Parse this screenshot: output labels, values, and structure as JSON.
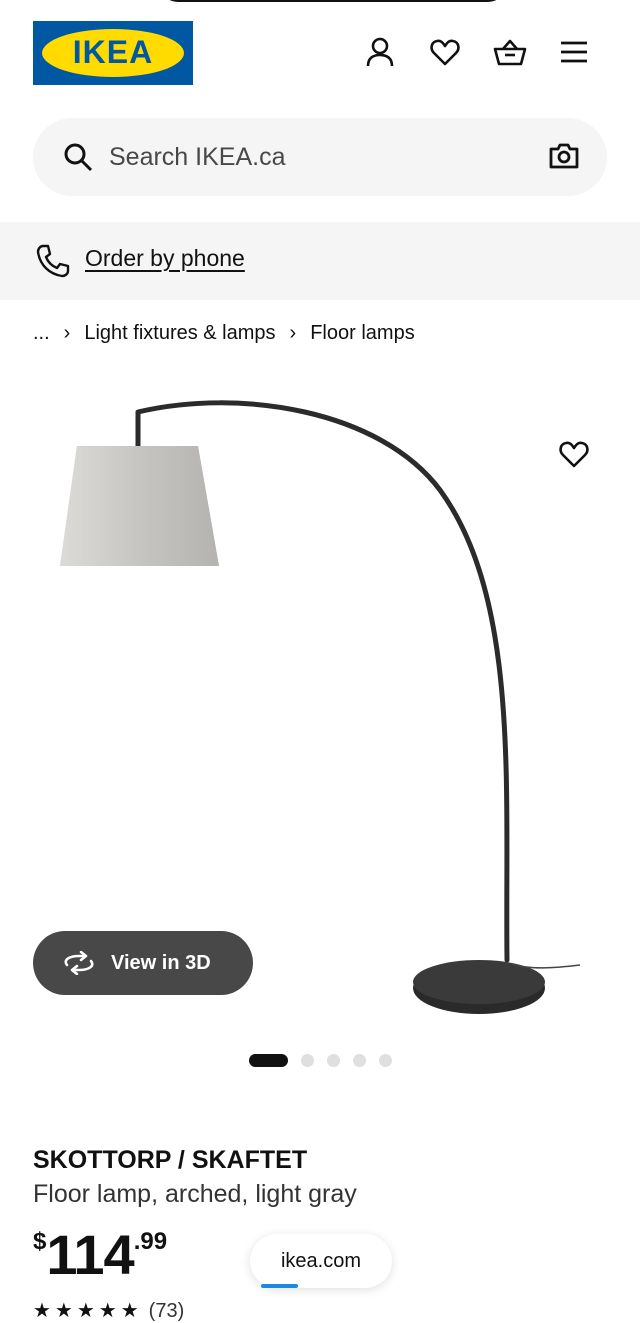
{
  "header": {
    "logo_text": "IKEA",
    "logo_reg": "®",
    "icons": [
      "account-icon",
      "heart-icon",
      "basket-icon",
      "menu-icon"
    ]
  },
  "search": {
    "placeholder": "Search IKEA.ca",
    "value": ""
  },
  "phone": {
    "label": "Order by phone"
  },
  "breadcrumb": {
    "ellipsis": "...",
    "items": [
      "Light fixtures & lamps",
      "Floor lamps"
    ]
  },
  "gallery": {
    "view3d_label": "View in 3D",
    "image_count": 5,
    "active_index": 0
  },
  "product": {
    "name": "SKOTTORP / SKAFTET",
    "description": "Floor lamp, arched, light gray",
    "price_currency": "$",
    "price_integer": "114",
    "price_decimal": ".99",
    "rating_stars": "★★★★★",
    "review_count": "(73)"
  },
  "browser": {
    "url": "ikea.com"
  },
  "colors": {
    "brand_blue": "#0058a3",
    "brand_yellow": "#ffdb00",
    "progress_blue": "#1e88e5"
  }
}
